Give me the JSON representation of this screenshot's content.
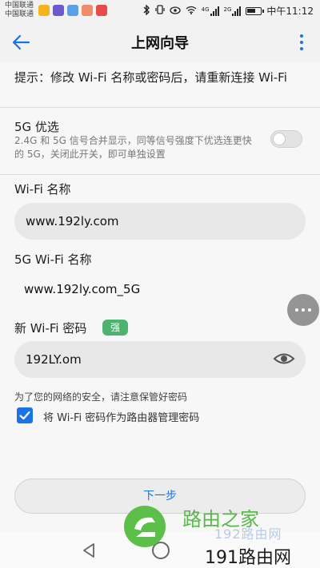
{
  "status_bar": {
    "carrier_1": "中国联通",
    "carrier_2": "中国联通",
    "network_1": "4G",
    "network_2": "2G",
    "time": "中午11:12"
  },
  "app_bar": {
    "title": "上网向导",
    "back_icon": "arrow-left-icon",
    "more_icon": "more-vertical-icon"
  },
  "hint": "提示：修改 Wi-Fi 名称或密码后，请重新连接 Wi-Fi",
  "pref_5g": {
    "title": "5G 优选",
    "description": "2.4G 和 5G 信号合并显示，同等信号强度下优选连更快的 5G，关闭此开关，即可单独设置",
    "enabled": false
  },
  "wifi_name": {
    "label": "Wi-Fi 名称",
    "value": "www.192ly.com"
  },
  "wifi_5g_name": {
    "label": "5G Wi-Fi 名称",
    "value": "www.192ly.com_5G"
  },
  "new_password": {
    "label": "新 Wi-Fi 密码",
    "strength_badge": "强",
    "value": "192LY.om",
    "eye_icon": "eye-icon"
  },
  "security_note": "为了您的网络的安全，请注意保管好密码",
  "admin_checkbox": {
    "label": "将 Wi-Fi 密码作为路由器管理密码",
    "checked": true
  },
  "next_button": "下一步",
  "watermark": {
    "brand_cn": "路由之家",
    "brand_faint": "192路由网",
    "brand_site": "191路由网"
  },
  "colors": {
    "accent": "#1a73e8",
    "badge_green": "#4db36e",
    "watermark_green": "#59b84a"
  }
}
